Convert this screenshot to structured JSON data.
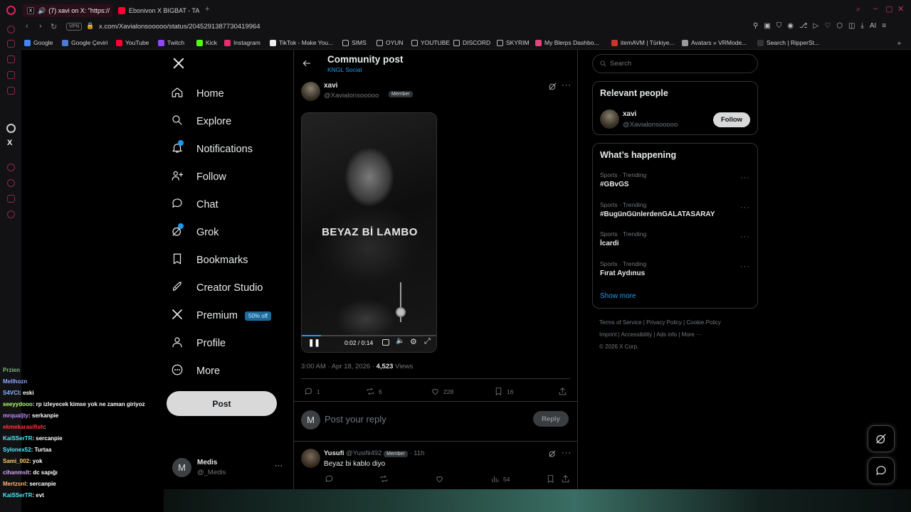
{
  "browser": {
    "tabs": [
      {
        "label": "(7) xavi on X: \"https://",
        "color": "#e5e5e5"
      },
      {
        "label": "Ebonivon X BIGBAT - TAM",
        "color": "#ff0033"
      }
    ],
    "url": "x.com/Xavialonsooooo/status/2045291387730419964",
    "vpn_label": "VPN",
    "bookmarks": [
      {
        "label": "Google",
        "icon": "google-icon",
        "color": "#4285f4"
      },
      {
        "label": "Google Çeviri",
        "icon": "translate-icon",
        "color": "#4a7bd6"
      },
      {
        "label": "YouTube",
        "icon": "youtube-icon",
        "color": "#ff0033"
      },
      {
        "label": "Twitch",
        "icon": "twitch-icon",
        "color": "#9146ff"
      },
      {
        "label": "Kick",
        "icon": "kick-icon",
        "color": "#53fc18"
      },
      {
        "label": "Instagram",
        "icon": "instagram-icon",
        "color": "#e1306c"
      },
      {
        "label": "TikTok - Make You...",
        "icon": "tiktok-icon",
        "color": "#eeeeee"
      },
      {
        "label": "SIMS",
        "icon": "folder-icon",
        "color": "#bbbbbb"
      },
      {
        "label": "OYUN",
        "icon": "folder-icon",
        "color": "#bbbbbb"
      },
      {
        "label": "YOUTUBE",
        "icon": "folder-icon",
        "color": "#bbbbbb"
      },
      {
        "label": "DISCORD",
        "icon": "folder-icon",
        "color": "#bbbbbb"
      },
      {
        "label": "SKYRIM",
        "icon": "folder-icon",
        "color": "#bbbbbb"
      },
      {
        "label": "My Blerps Dashbo...",
        "icon": "blerp-icon",
        "color": "#e0457b"
      },
      {
        "label": "itemAVM | Türkiye...",
        "icon": "item-icon",
        "color": "#c0392b"
      },
      {
        "label": "Avatars » VRMode...",
        "icon": "vr-icon",
        "color": "#999999"
      },
      {
        "label": "Search | RipperSt...",
        "icon": "ripper-icon",
        "color": "#333333"
      }
    ]
  },
  "nav": {
    "items": [
      {
        "label": "Home",
        "icon": "home-icon"
      },
      {
        "label": "Explore",
        "icon": "search-icon"
      },
      {
        "label": "Notifications",
        "icon": "bell-icon"
      },
      {
        "label": "Follow",
        "icon": "follow-icon"
      },
      {
        "label": "Chat",
        "icon": "chat-icon"
      },
      {
        "label": "Grok",
        "icon": "grok-icon"
      },
      {
        "label": "Bookmarks",
        "icon": "bookmark-icon"
      },
      {
        "label": "Creator Studio",
        "icon": "rocket-icon"
      },
      {
        "label": "Premium",
        "icon": "x-logo-icon",
        "badge": "50% off"
      },
      {
        "label": "Profile",
        "icon": "person-icon"
      },
      {
        "label": "More",
        "icon": "more-circle-icon"
      }
    ],
    "post_button": "Post",
    "account": {
      "name": "Medis",
      "handle": "@_Medis",
      "initial": "M",
      "more": "···"
    }
  },
  "post": {
    "header_title": "Community post",
    "community": "KNGL Social",
    "author_name": "xavi",
    "author_handle": "@Xavialonsooooo",
    "member_badge": "Member",
    "video_text": "BEYAZ Bİ LAMBO",
    "video_time": "0:02 / 0:14",
    "video_progress": 0.14,
    "volume_level": 0.25,
    "timestamp": "3:00 AM · Apr 18, 2026 · ",
    "views_count": "4,523",
    "views_label": " Views",
    "replies": "1",
    "reposts": "6",
    "likes": "228",
    "bookmarks": "16",
    "reply_placeholder": "Post your reply",
    "reply_button": "Reply",
    "reply_avatar": "M"
  },
  "comment": {
    "name": "Yusufi",
    "handle": "@Yusifii492",
    "badge": "Member",
    "time": "· 11h",
    "text": "Beyaz bi kablo diyo",
    "views": "54"
  },
  "sidebar": {
    "search_placeholder": "Search",
    "relevant_title": "Relevant people",
    "person_name": "xavi",
    "person_handle": "@Xavialonsooooo",
    "follow_label": "Follow",
    "happening_title": "What’s happening",
    "trends": [
      {
        "category": "Sports · Trending",
        "name": "#GBvGS"
      },
      {
        "category": "Sports · Trending",
        "name": "#BugünGünlerdenGALATASARAY"
      },
      {
        "category": "Sports · Trending",
        "name": "İcardi"
      },
      {
        "category": "Sports · Trending",
        "name": "Fırat Aydınus"
      }
    ],
    "show_more": "Show more",
    "footer": {
      "links1": [
        "Terms of Service",
        "Privacy Policy",
        "Cookie Policy"
      ],
      "links2": [
        "Imprint",
        "Accessibility",
        "Ads info",
        "More ···"
      ],
      "copyright": "© 2026 X Corp."
    }
  },
  "chat": [
    {
      "user": "Przien",
      "msg": "",
      "color": "#7fb37f"
    },
    {
      "user": "Mellhozn",
      "msg": "",
      "color": "#8aa8ff"
    },
    {
      "user": "S4VCI",
      "msg": ": eski",
      "color": "#8ab6ff"
    },
    {
      "user": "seeyydooo",
      "msg": ": rp izleyecek kimse yok ne zaman giriyoz",
      "color": "#b6ff6a"
    },
    {
      "user": "mrqualjty",
      "msg": ": serkanpie",
      "color": "#c58bff"
    },
    {
      "user": "ekmekarasifish",
      "msg": ": ",
      "color": "#ff3b3b"
    },
    {
      "user": "KaiSSerTR",
      "msg": ": sercanpie",
      "color": "#4ff0ff"
    },
    {
      "user": "Sylonex52",
      "msg": ": Turtaa",
      "color": "#4ff0ff"
    },
    {
      "user": "Sami_002",
      "msg": ": yok",
      "color": "#ffd36a"
    },
    {
      "user": "cihanmslt",
      "msg": ": dc sapığı",
      "color": "#d6a6ff"
    },
    {
      "user": "Mertzsnl",
      "msg": ": sercanpie",
      "color": "#ffb36a"
    },
    {
      "user": "KaiSSerTR",
      "msg": ": evt",
      "color": "#4ff0ff"
    }
  ],
  "colors": {
    "accent": "#1d9bf0",
    "opera": "#e0245e",
    "premium_badge": "#1d9bf0"
  }
}
